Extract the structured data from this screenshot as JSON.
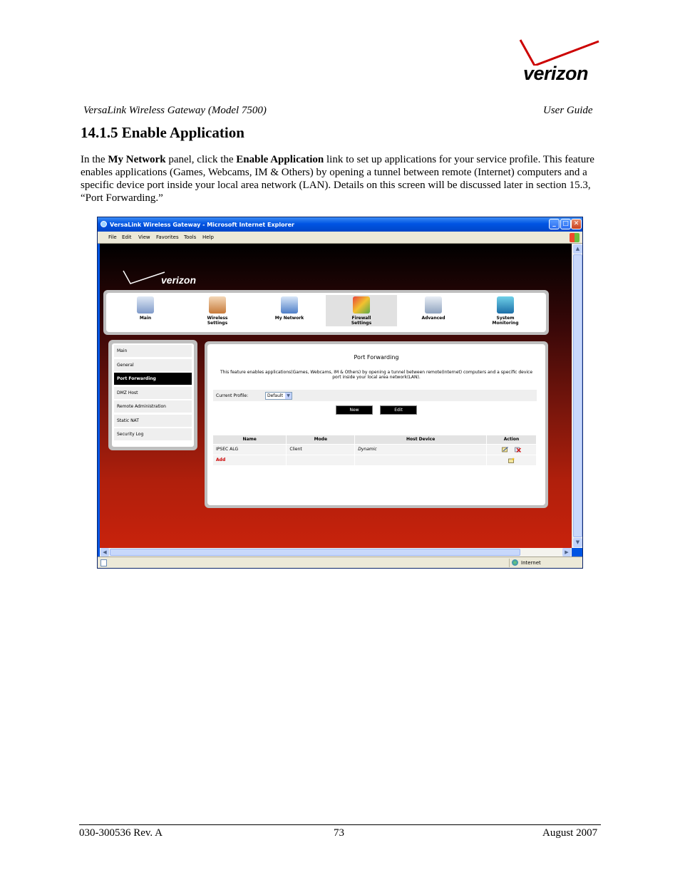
{
  "brand": {
    "logo_text": "verizon"
  },
  "doc_header": {
    "left": "VersaLink Wireless Gateway (Model 7500)",
    "right": "User Guide"
  },
  "section": {
    "title": "14.1.5 Enable Application"
  },
  "intro": {
    "p1": "In the ",
    "b1": "My Network",
    "p2": " panel, click the ",
    "b2": "Enable Application",
    "p3": " link to set up applications for your service profile. This feature enables applications (Games, Webcams, IM & Others) by opening a tunnel between remote (Internet) computers and a specific device port inside your local area network (LAN). Details on this screen will be discussed later in section 15.3, “Port Forwarding.”"
  },
  "footer": {
    "left": "030-300536 Rev. A",
    "center": "73",
    "right": "August 2007"
  },
  "screenshot": {
    "window_title": "VersaLink Wireless Gateway - Microsoft Internet Explorer",
    "menu": [
      "File",
      "Edit",
      "View",
      "Favorites",
      "Tools",
      "Help"
    ],
    "site_logo": "verizon",
    "top_nav": [
      {
        "line1": "Main",
        "line2": ""
      },
      {
        "line1": "Wireless",
        "line2": "Settings"
      },
      {
        "line1": "My Network",
        "line2": ""
      },
      {
        "line1": "Firewall",
        "line2": "Settings"
      },
      {
        "line1": "Advanced",
        "line2": ""
      },
      {
        "line1": "System",
        "line2": "Monitoring"
      }
    ],
    "side_nav": [
      "Main",
      "General",
      "Port Forwarding",
      "DMZ Host",
      "Remote Administration",
      "Static NAT",
      "Security Log"
    ],
    "panel": {
      "title": "Port Forwarding",
      "description": "This feature enables applications(Games, Webcams, IM & Others) by opening a tunnel between remote(Internet) computers and a specific device port inside your local area network(LAN).",
      "profile_label": "Current Profile:",
      "profile_value": "Default",
      "new_button": "New",
      "edit_button": "Edit",
      "table": {
        "headers": [
          "Name",
          "Mode",
          "Host Device",
          "Action"
        ],
        "row1": {
          "name": "IPSEC ALG",
          "mode": "Client",
          "host": "Dynamic"
        },
        "add_label": "Add"
      }
    },
    "status": {
      "zone": "Internet"
    },
    "colors": {
      "title_blue": "#0054e3",
      "accent_red": "#cc0000"
    }
  }
}
